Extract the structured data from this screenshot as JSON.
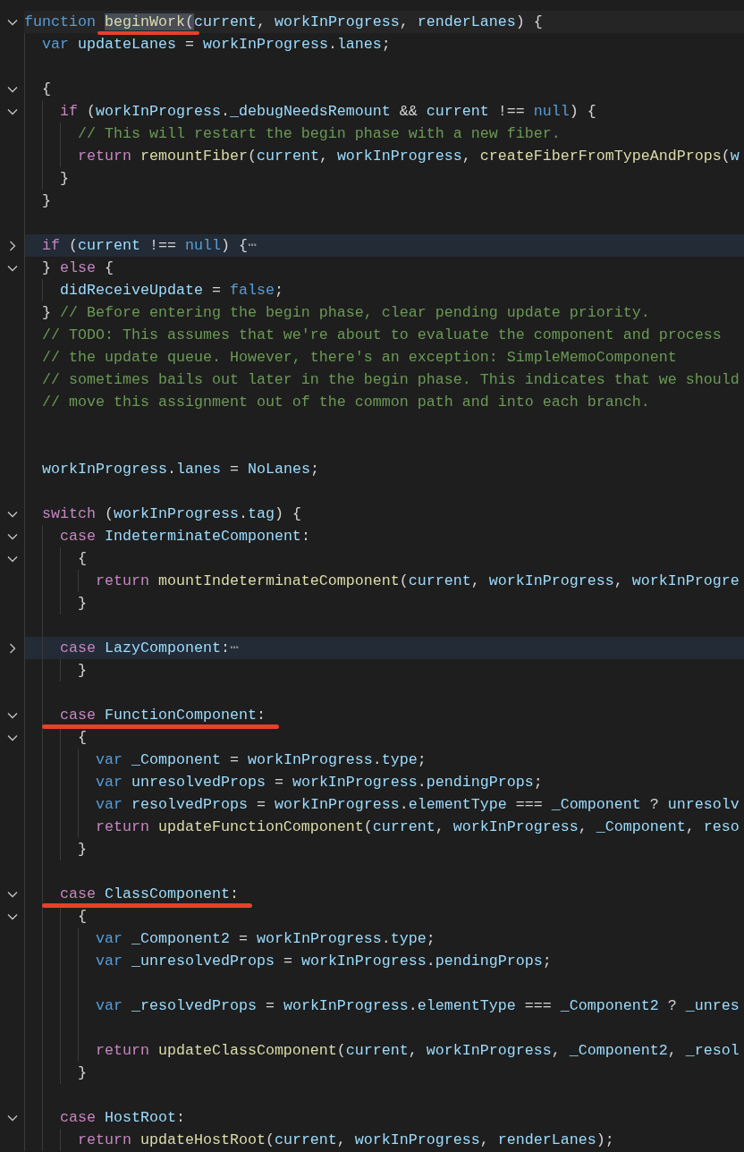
{
  "editor": {
    "lines": [
      {
        "kind": "code",
        "collapsed": false,
        "current": true,
        "tokens": [
          {
            "text": "function ",
            "kind": "keyword"
          },
          {
            "text": "beginWork",
            "kind": "function",
            "highlighted": true,
            "underlined": true
          },
          {
            "text": "(",
            "kind": "punctuation",
            "highlighted": true,
            "underlined": true
          },
          {
            "text": "current",
            "kind": "variable"
          },
          {
            "text": ", ",
            "kind": "punctuation"
          },
          {
            "text": "workInProgress",
            "kind": "variable"
          },
          {
            "text": ", ",
            "kind": "punctuation"
          },
          {
            "text": "renderLanes",
            "kind": "variable"
          },
          {
            "text": ") {",
            "kind": "punctuation"
          }
        ]
      },
      {
        "kind": "code",
        "tokens": [
          {
            "text": "  var ",
            "kind": "keyword"
          },
          {
            "text": "updateLanes",
            "kind": "variable"
          },
          {
            "text": " = ",
            "kind": "punctuation"
          },
          {
            "text": "workInProgress",
            "kind": "variable"
          },
          {
            "text": ".",
            "kind": "punctuation"
          },
          {
            "text": "lanes",
            "kind": "variable"
          },
          {
            "text": ";",
            "kind": "punctuation"
          }
        ]
      },
      {
        "kind": "blank"
      },
      {
        "kind": "code",
        "collapsed": false,
        "tokens": [
          {
            "text": "  {",
            "kind": "punctuation"
          }
        ]
      },
      {
        "kind": "code",
        "collapsed": false,
        "tokens": [
          {
            "text": "    if ",
            "kind": "control"
          },
          {
            "text": "(",
            "kind": "punctuation"
          },
          {
            "text": "workInProgress",
            "kind": "variable"
          },
          {
            "text": ".",
            "kind": "punctuation"
          },
          {
            "text": "_debugNeedsRemount",
            "kind": "variable"
          },
          {
            "text": " && ",
            "kind": "punctuation"
          },
          {
            "text": "current",
            "kind": "variable"
          },
          {
            "text": " !== ",
            "kind": "punctuation"
          },
          {
            "text": "null",
            "kind": "keyword"
          },
          {
            "text": ") {",
            "kind": "punctuation"
          }
        ]
      },
      {
        "kind": "code",
        "tokens": [
          {
            "text": "      // This will restart the begin phase with a new fiber.",
            "kind": "comment"
          }
        ]
      },
      {
        "kind": "code",
        "tokens": [
          {
            "text": "      return ",
            "kind": "control"
          },
          {
            "text": "remountFiber",
            "kind": "function"
          },
          {
            "text": "(",
            "kind": "punctuation"
          },
          {
            "text": "current",
            "kind": "variable"
          },
          {
            "text": ", ",
            "kind": "punctuation"
          },
          {
            "text": "workInProgress",
            "kind": "variable"
          },
          {
            "text": ", ",
            "kind": "punctuation"
          },
          {
            "text": "createFiberFromTypeAndProps",
            "kind": "function"
          },
          {
            "text": "(",
            "kind": "punctuation"
          },
          {
            "text": "w",
            "kind": "variable"
          }
        ]
      },
      {
        "kind": "code",
        "tokens": [
          {
            "text": "    }",
            "kind": "punctuation"
          }
        ]
      },
      {
        "kind": "code",
        "tokens": [
          {
            "text": "  }",
            "kind": "punctuation"
          }
        ]
      },
      {
        "kind": "blank"
      },
      {
        "kind": "code",
        "collapsed": true,
        "tokens": [
          {
            "text": "  if ",
            "kind": "control"
          },
          {
            "text": "(",
            "kind": "punctuation"
          },
          {
            "text": "current",
            "kind": "variable"
          },
          {
            "text": " !== ",
            "kind": "punctuation"
          },
          {
            "text": "null",
            "kind": "keyword"
          },
          {
            "text": ") {",
            "kind": "punctuation"
          },
          {
            "text": "⋯",
            "kind": "ellipsis"
          }
        ]
      },
      {
        "kind": "code",
        "collapsed": false,
        "tokens": [
          {
            "text": "  } ",
            "kind": "punctuation"
          },
          {
            "text": "else",
            "kind": "control"
          },
          {
            "text": " {",
            "kind": "punctuation"
          }
        ]
      },
      {
        "kind": "code",
        "tokens": [
          {
            "text": "    didReceiveUpdate",
            "kind": "variable"
          },
          {
            "text": " = ",
            "kind": "punctuation"
          },
          {
            "text": "false",
            "kind": "keyword"
          },
          {
            "text": ";",
            "kind": "punctuation"
          }
        ]
      },
      {
        "kind": "code",
        "tokens": [
          {
            "text": "  } ",
            "kind": "punctuation"
          },
          {
            "text": "// Before entering the begin phase, clear pending update priority.",
            "kind": "comment"
          }
        ]
      },
      {
        "kind": "code",
        "tokens": [
          {
            "text": "  // TODO: This assumes that we're about to evaluate the component and process",
            "kind": "comment"
          }
        ]
      },
      {
        "kind": "code",
        "tokens": [
          {
            "text": "  // the update queue. However, there's an exception: SimpleMemoComponent",
            "kind": "comment"
          }
        ]
      },
      {
        "kind": "code",
        "tokens": [
          {
            "text": "  // sometimes bails out later in the begin phase. This indicates that we should",
            "kind": "comment"
          }
        ]
      },
      {
        "kind": "code",
        "tokens": [
          {
            "text": "  // move this assignment out of the common path and into each branch.",
            "kind": "comment"
          }
        ]
      },
      {
        "kind": "blank"
      },
      {
        "kind": "blank"
      },
      {
        "kind": "code",
        "tokens": [
          {
            "text": "  workInProgress",
            "kind": "variable"
          },
          {
            "text": ".",
            "kind": "punctuation"
          },
          {
            "text": "lanes",
            "kind": "variable"
          },
          {
            "text": " = ",
            "kind": "punctuation"
          },
          {
            "text": "NoLanes",
            "kind": "variable"
          },
          {
            "text": ";",
            "kind": "punctuation"
          }
        ]
      },
      {
        "kind": "blank"
      },
      {
        "kind": "code",
        "collapsed": false,
        "tokens": [
          {
            "text": "  switch ",
            "kind": "control"
          },
          {
            "text": "(",
            "kind": "punctuation"
          },
          {
            "text": "workInProgress",
            "kind": "variable"
          },
          {
            "text": ".",
            "kind": "punctuation"
          },
          {
            "text": "tag",
            "kind": "variable"
          },
          {
            "text": ") {",
            "kind": "punctuation"
          }
        ]
      },
      {
        "kind": "code",
        "collapsed": false,
        "tokens": [
          {
            "text": "    case ",
            "kind": "control"
          },
          {
            "text": "IndeterminateComponent",
            "kind": "variable"
          },
          {
            "text": ":",
            "kind": "punctuation"
          }
        ]
      },
      {
        "kind": "code",
        "collapsed": false,
        "tokens": [
          {
            "text": "      {",
            "kind": "punctuation"
          }
        ]
      },
      {
        "kind": "code",
        "tokens": [
          {
            "text": "        return ",
            "kind": "control"
          },
          {
            "text": "mountIndeterminateComponent",
            "kind": "function"
          },
          {
            "text": "(",
            "kind": "punctuation"
          },
          {
            "text": "current",
            "kind": "variable"
          },
          {
            "text": ", ",
            "kind": "punctuation"
          },
          {
            "text": "workInProgress",
            "kind": "variable"
          },
          {
            "text": ", ",
            "kind": "punctuation"
          },
          {
            "text": "workInProgre",
            "kind": "variable"
          }
        ]
      },
      {
        "kind": "code",
        "tokens": [
          {
            "text": "      }",
            "kind": "punctuation"
          }
        ]
      },
      {
        "kind": "blank"
      },
      {
        "kind": "code",
        "collapsed": true,
        "tokens": [
          {
            "text": "    case ",
            "kind": "control"
          },
          {
            "text": "LazyComponent",
            "kind": "variable"
          },
          {
            "text": ":",
            "kind": "punctuation"
          },
          {
            "text": "⋯",
            "kind": "ellipsis"
          }
        ]
      },
      {
        "kind": "code",
        "tokens": [
          {
            "text": "      }",
            "kind": "punctuation"
          }
        ]
      },
      {
        "kind": "blank"
      },
      {
        "kind": "code",
        "collapsed": false,
        "underlined": true,
        "tokens": [
          {
            "text": "    case ",
            "kind": "control"
          },
          {
            "text": "FunctionComponent",
            "kind": "variable"
          },
          {
            "text": ":",
            "kind": "punctuation"
          }
        ]
      },
      {
        "kind": "code",
        "collapsed": false,
        "tokens": [
          {
            "text": "      {",
            "kind": "punctuation"
          }
        ]
      },
      {
        "kind": "code",
        "tokens": [
          {
            "text": "        var ",
            "kind": "keyword"
          },
          {
            "text": "_Component",
            "kind": "variable"
          },
          {
            "text": " = ",
            "kind": "punctuation"
          },
          {
            "text": "workInProgress",
            "kind": "variable"
          },
          {
            "text": ".",
            "kind": "punctuation"
          },
          {
            "text": "type",
            "kind": "variable"
          },
          {
            "text": ";",
            "kind": "punctuation"
          }
        ]
      },
      {
        "kind": "code",
        "tokens": [
          {
            "text": "        var ",
            "kind": "keyword"
          },
          {
            "text": "unresolvedProps",
            "kind": "variable"
          },
          {
            "text": " = ",
            "kind": "punctuation"
          },
          {
            "text": "workInProgress",
            "kind": "variable"
          },
          {
            "text": ".",
            "kind": "punctuation"
          },
          {
            "text": "pendingProps",
            "kind": "variable"
          },
          {
            "text": ";",
            "kind": "punctuation"
          }
        ]
      },
      {
        "kind": "code",
        "tokens": [
          {
            "text": "        var ",
            "kind": "keyword"
          },
          {
            "text": "resolvedProps",
            "kind": "variable"
          },
          {
            "text": " = ",
            "kind": "punctuation"
          },
          {
            "text": "workInProgress",
            "kind": "variable"
          },
          {
            "text": ".",
            "kind": "punctuation"
          },
          {
            "text": "elementType",
            "kind": "variable"
          },
          {
            "text": " === ",
            "kind": "punctuation"
          },
          {
            "text": "_Component",
            "kind": "variable"
          },
          {
            "text": " ? ",
            "kind": "punctuation"
          },
          {
            "text": "unresolv",
            "kind": "variable"
          }
        ]
      },
      {
        "kind": "code",
        "tokens": [
          {
            "text": "        return ",
            "kind": "control"
          },
          {
            "text": "updateFunctionComponent",
            "kind": "function"
          },
          {
            "text": "(",
            "kind": "punctuation"
          },
          {
            "text": "current",
            "kind": "variable"
          },
          {
            "text": ", ",
            "kind": "punctuation"
          },
          {
            "text": "workInProgress",
            "kind": "variable"
          },
          {
            "text": ", ",
            "kind": "punctuation"
          },
          {
            "text": "_Component",
            "kind": "variable"
          },
          {
            "text": ", ",
            "kind": "punctuation"
          },
          {
            "text": "reso",
            "kind": "variable"
          }
        ]
      },
      {
        "kind": "code",
        "tokens": [
          {
            "text": "      }",
            "kind": "punctuation"
          }
        ]
      },
      {
        "kind": "blank"
      },
      {
        "kind": "code",
        "collapsed": false,
        "underlined": true,
        "tokens": [
          {
            "text": "    case ",
            "kind": "control"
          },
          {
            "text": "ClassComponent",
            "kind": "variable"
          },
          {
            "text": ":",
            "kind": "punctuation"
          }
        ]
      },
      {
        "kind": "code",
        "collapsed": false,
        "tokens": [
          {
            "text": "      {",
            "kind": "punctuation"
          }
        ]
      },
      {
        "kind": "code",
        "tokens": [
          {
            "text": "        var ",
            "kind": "keyword"
          },
          {
            "text": "_Component2",
            "kind": "variable"
          },
          {
            "text": " = ",
            "kind": "punctuation"
          },
          {
            "text": "workInProgress",
            "kind": "variable"
          },
          {
            "text": ".",
            "kind": "punctuation"
          },
          {
            "text": "type",
            "kind": "variable"
          },
          {
            "text": ";",
            "kind": "punctuation"
          }
        ]
      },
      {
        "kind": "code",
        "tokens": [
          {
            "text": "        var ",
            "kind": "keyword"
          },
          {
            "text": "_unresolvedProps",
            "kind": "variable"
          },
          {
            "text": " = ",
            "kind": "punctuation"
          },
          {
            "text": "workInProgress",
            "kind": "variable"
          },
          {
            "text": ".",
            "kind": "punctuation"
          },
          {
            "text": "pendingProps",
            "kind": "variable"
          },
          {
            "text": ";",
            "kind": "punctuation"
          }
        ]
      },
      {
        "kind": "blank"
      },
      {
        "kind": "code",
        "tokens": [
          {
            "text": "        var ",
            "kind": "keyword"
          },
          {
            "text": "_resolvedProps",
            "kind": "variable"
          },
          {
            "text": " = ",
            "kind": "punctuation"
          },
          {
            "text": "workInProgress",
            "kind": "variable"
          },
          {
            "text": ".",
            "kind": "punctuation"
          },
          {
            "text": "elementType",
            "kind": "variable"
          },
          {
            "text": " === ",
            "kind": "punctuation"
          },
          {
            "text": "_Component2",
            "kind": "variable"
          },
          {
            "text": " ? ",
            "kind": "punctuation"
          },
          {
            "text": "_unres",
            "kind": "variable"
          }
        ]
      },
      {
        "kind": "blank"
      },
      {
        "kind": "code",
        "tokens": [
          {
            "text": "        return ",
            "kind": "control"
          },
          {
            "text": "updateClassComponent",
            "kind": "function"
          },
          {
            "text": "(",
            "kind": "punctuation"
          },
          {
            "text": "current",
            "kind": "variable"
          },
          {
            "text": ", ",
            "kind": "punctuation"
          },
          {
            "text": "workInProgress",
            "kind": "variable"
          },
          {
            "text": ", ",
            "kind": "punctuation"
          },
          {
            "text": "_Component2",
            "kind": "variable"
          },
          {
            "text": ", ",
            "kind": "punctuation"
          },
          {
            "text": "_resol",
            "kind": "variable"
          }
        ]
      },
      {
        "kind": "code",
        "tokens": [
          {
            "text": "      }",
            "kind": "punctuation"
          }
        ]
      },
      {
        "kind": "blank"
      },
      {
        "kind": "code",
        "collapsed": false,
        "tokens": [
          {
            "text": "    case ",
            "kind": "control"
          },
          {
            "text": "HostRoot",
            "kind": "variable"
          },
          {
            "text": ":",
            "kind": "punctuation"
          }
        ]
      },
      {
        "kind": "code",
        "tokens": [
          {
            "text": "      return ",
            "kind": "control"
          },
          {
            "text": "updateHostRoot",
            "kind": "function"
          },
          {
            "text": "(",
            "kind": "punctuation"
          },
          {
            "text": "current",
            "kind": "variable"
          },
          {
            "text": ", ",
            "kind": "punctuation"
          },
          {
            "text": "workInProgress",
            "kind": "variable"
          },
          {
            "text": ", ",
            "kind": "punctuation"
          },
          {
            "text": "renderLanes",
            "kind": "variable"
          },
          {
            "text": ");",
            "kind": "punctuation"
          }
        ]
      }
    ]
  }
}
